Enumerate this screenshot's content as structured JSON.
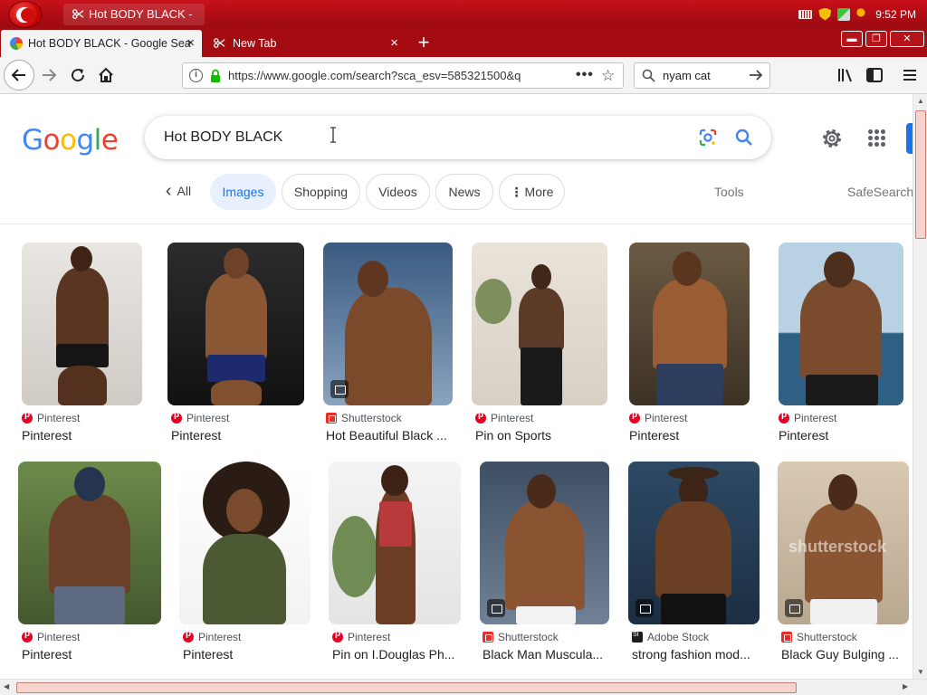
{
  "window": {
    "title": "Hot BODY BLACK - ...",
    "clock": "9:52 PM"
  },
  "tabs": [
    {
      "label": "Hot BODY BLACK - Google Sea",
      "close": "×"
    },
    {
      "label": "New Tab",
      "close": "×"
    }
  ],
  "new_tab": "+",
  "window_controls": {
    "minimize": "▬",
    "maximize": "❐",
    "close": "✕"
  },
  "nav": {
    "url": "https://www.google.com/search?sca_esv=585321500&q",
    "page_actions": "•••",
    "bookmark_star": "☆",
    "search_value": "nyam cat"
  },
  "google": {
    "logo_letters": [
      "G",
      "o",
      "o",
      "g",
      "l",
      "e"
    ],
    "query": "Hot BODY BLACK",
    "chips": [
      {
        "label": "All",
        "prefix": "‹"
      },
      {
        "label": "Images"
      },
      {
        "label": "Shopping"
      },
      {
        "label": "Videos"
      },
      {
        "label": "News"
      },
      {
        "label": "More",
        "prefix": "⋮"
      }
    ],
    "tools": "Tools",
    "safesearch": "SafeSearch"
  },
  "results": [
    {
      "source": "Pinterest",
      "title": "Pinterest",
      "icon": "pinterest-icon"
    },
    {
      "source": "Pinterest",
      "title": "Pinterest",
      "icon": "pinterest-icon"
    },
    {
      "source": "Shutterstock",
      "title": "Hot Beautiful Black ...",
      "icon": "shutterstock-icon"
    },
    {
      "source": "Pinterest",
      "title": "Pin on Sports",
      "icon": "pinterest-icon"
    },
    {
      "source": "Pinterest",
      "title": "Pinterest",
      "icon": "pinterest-icon"
    },
    {
      "source": "Pinterest",
      "title": "Pinterest",
      "icon": "pinterest-icon"
    },
    {
      "source": "Pinterest",
      "title": "Pinterest",
      "icon": "pinterest-icon"
    },
    {
      "source": "Pinterest",
      "title": "Pinterest",
      "icon": "pinterest-icon"
    },
    {
      "source": "Pinterest",
      "title": "Pin on I.Douglas Ph...",
      "icon": "pinterest-icon"
    },
    {
      "source": "Shutterstock",
      "title": "Black Man Muscula...",
      "icon": "shutterstock-icon"
    },
    {
      "source": "Adobe Stock",
      "title": "strong fashion mod...",
      "icon": "adobe-stock-icon"
    },
    {
      "source": "Shutterstock",
      "title": "Black Guy Bulging ...",
      "icon": "shutterstock-icon"
    }
  ],
  "watermarks": [
    "shutterstock"
  ],
  "colors": {
    "browser_chrome": "#b0121a",
    "google_blue": "#4285f4",
    "google_red": "#ea4335",
    "google_yellow": "#fbbc05",
    "google_green": "#34a853",
    "selected_chip_bg": "#e8f0fe",
    "selected_chip_text": "#1a73e8"
  }
}
